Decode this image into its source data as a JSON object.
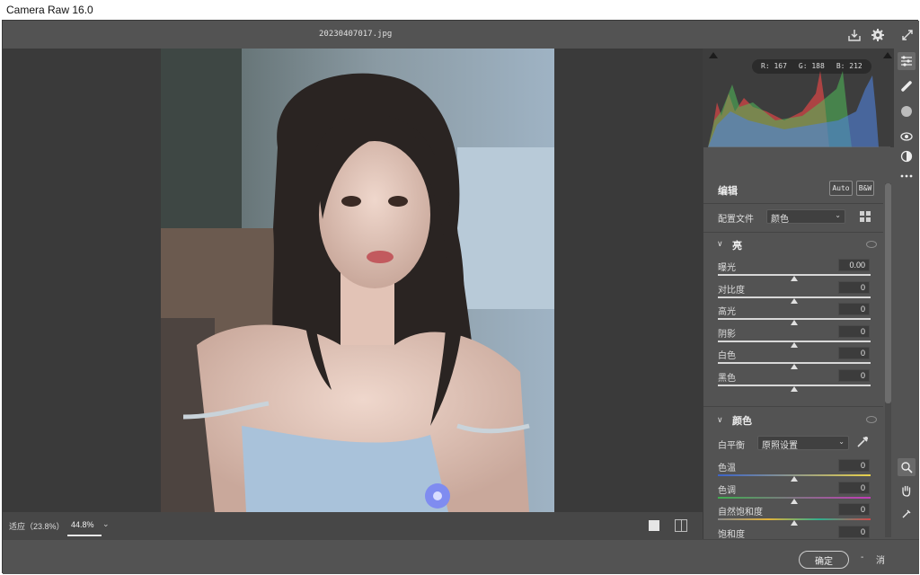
{
  "window": {
    "title": "Camera Raw 16.0",
    "filename": "20230407017.jpg"
  },
  "topbar": {
    "icons": [
      "save-icon",
      "gear-icon",
      "fullscreen-icon"
    ]
  },
  "histogram": {
    "r": "R: 167",
    "g": "G: 188",
    "b": "B: 212"
  },
  "edit": {
    "title": "编辑",
    "auto_label": "Auto",
    "bw_label": "B&W"
  },
  "profile": {
    "label": "配置文件",
    "value": "颜色"
  },
  "light": {
    "title": "亮",
    "sliders": [
      {
        "label": "曝光",
        "value": "0.00",
        "pos": 0.5
      },
      {
        "label": "对比度",
        "value": "0",
        "pos": 0.5
      },
      {
        "label": "高光",
        "value": "0",
        "pos": 0.5
      },
      {
        "label": "阴影",
        "value": "0",
        "pos": 0.5
      },
      {
        "label": "白色",
        "value": "0",
        "pos": 0.5
      },
      {
        "label": "黑色",
        "value": "0",
        "pos": 0.5
      }
    ]
  },
  "color": {
    "title": "颜色",
    "wb_label": "白平衡",
    "wb_value": "原照设置",
    "sliders": [
      {
        "label": "色温",
        "value": "0",
        "pos": 0.5
      },
      {
        "label": "色调",
        "value": "0",
        "pos": 0.5
      },
      {
        "label": "自然饱和度",
        "value": "0",
        "pos": 0.5
      },
      {
        "label": "饱和度",
        "value": "0",
        "pos": 0.5
      }
    ]
  },
  "bottom": {
    "fit_label": "适应（23.8%）",
    "zoom_value": "44.8%"
  },
  "footer": {
    "ok_label": "确定",
    "cancel_label": "消"
  },
  "tools": [
    "sliders-icon",
    "healing-brush-icon",
    "mask-icon",
    "redeye-icon",
    "presets-icon",
    "more-icon",
    "zoom-icon",
    "hand-icon",
    "sample-icon"
  ]
}
